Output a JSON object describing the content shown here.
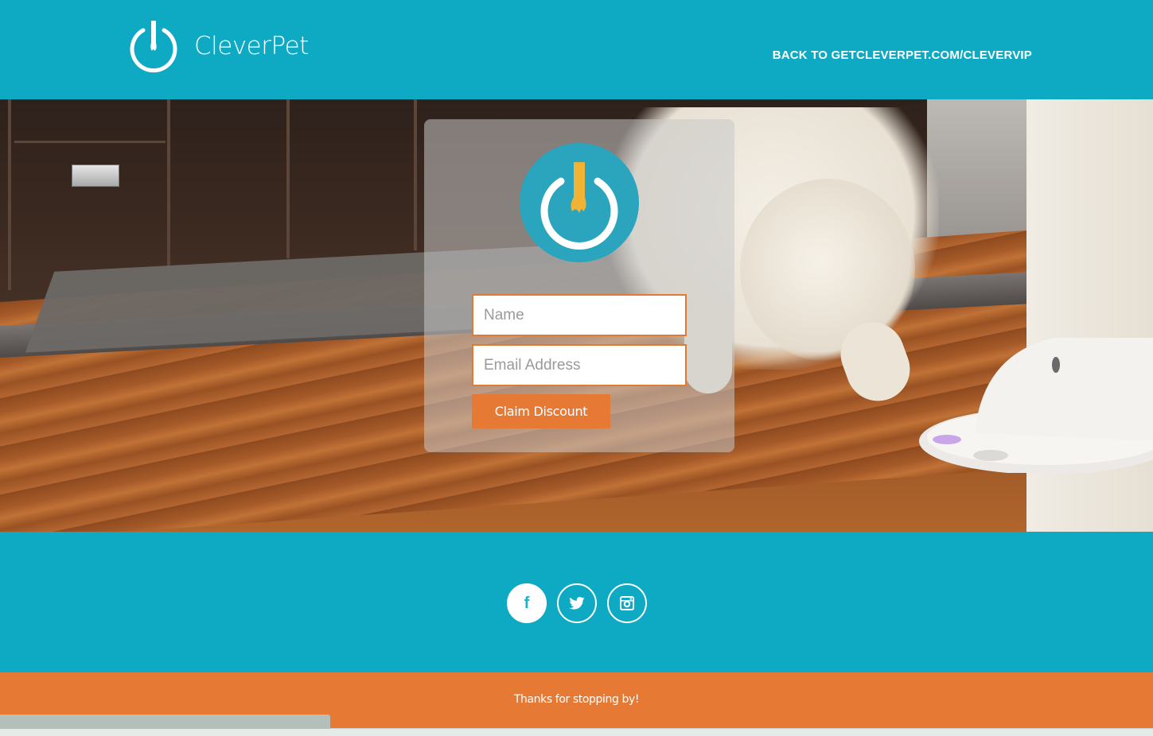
{
  "header": {
    "brand_name": "CleverPet",
    "back_link": "BACK TO GETCLEVERPET.COM/CLEVERVIP"
  },
  "form": {
    "name_placeholder": "Name",
    "email_placeholder": "Email Address",
    "submit_label": "Claim Discount"
  },
  "social": {
    "facebook_glyph": "f",
    "icons": [
      "facebook-icon",
      "twitter-icon",
      "instagram-icon"
    ]
  },
  "footer": {
    "text": "Thanks for stopping by!"
  },
  "colors": {
    "brand_teal": "#0eaac3",
    "accent_orange": "#e67a35",
    "logo_gold": "#f2b233"
  }
}
